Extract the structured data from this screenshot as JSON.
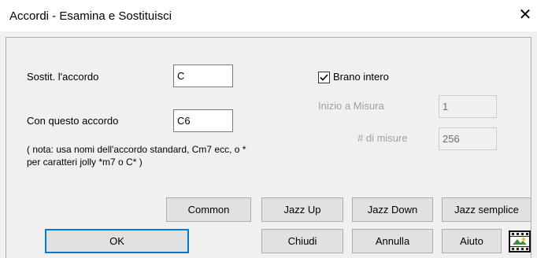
{
  "window": {
    "title": "Accordi - Esamina e Sostituisci",
    "close_glyph": "✕"
  },
  "form": {
    "replace_label": "Sostit. l'accordo",
    "replace_value": "C",
    "with_label": "Con questo accordo",
    "with_value": "C6",
    "note_line1": "( nota: usa nomi dell'accordo standard, Cm7 ecc, o *",
    "note_line2": "per caratteri jolly *m7 o C* )",
    "whole_song_label": "Brano intero",
    "whole_song_checked": true,
    "start_bar_label": "Inizio a Misura",
    "start_bar_value": "1",
    "num_bars_label": "# di misure",
    "num_bars_value": "256"
  },
  "buttons": {
    "common": "Common",
    "jazz_up": "Jazz Up",
    "jazz_down": "Jazz Down",
    "jazz_simple": "Jazz semplice",
    "ok": "OK",
    "close": "Chiudi",
    "cancel": "Annulla",
    "help": "Aiuto"
  },
  "icons": {
    "video_icon": "film-clapper-icon"
  }
}
